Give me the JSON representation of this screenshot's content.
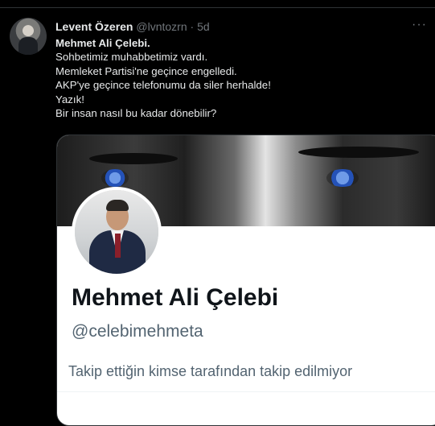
{
  "tweet": {
    "author_name": "Levent Özeren",
    "author_handle": "@lvntozrn",
    "separator": "·",
    "time": "5d",
    "more_glyph": "···",
    "lines": [
      "Mehmet Ali Çelebi.",
      "Sohbetimiz muhabbetimiz vardı.",
      "Memleket Partisi'ne geçince engelledi.",
      "AKP'ye geçince telefonumu da siler herhalde!",
      "Yazık!",
      "Bir insan nasıl bu kadar dönebilir?"
    ]
  },
  "profile_card": {
    "name": "Mehmet Ali Çelebi",
    "handle": "@celebimehmeta",
    "followed_note": "Takip ettiğin kimse tarafından takip edilmiyor"
  },
  "colors": {
    "background": "#000000",
    "text_primary": "#e7e9ea",
    "text_secondary": "#71767b",
    "card_background": "#ffffff",
    "card_name": "#0f1419",
    "card_secondary": "#536471"
  },
  "icons": [
    "more-icon",
    "author-avatar",
    "profile-photo",
    "banner-image"
  ]
}
